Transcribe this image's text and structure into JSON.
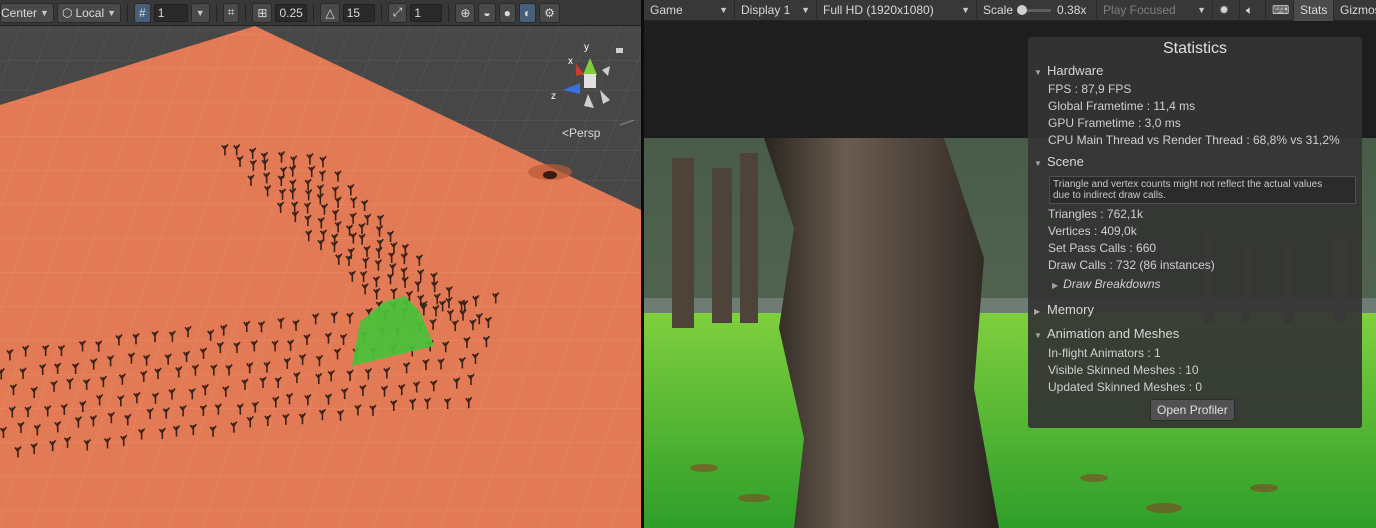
{
  "scene_toolbar": {
    "pivot_label": "Center",
    "space_label": "Local",
    "grid_value": "1",
    "snap_value": "0.25",
    "rotate_snap_value": "15",
    "scale_snap_value": "1"
  },
  "scene_view": {
    "camera_mode": "Persp",
    "gizmo_axes": {
      "x": "x",
      "y": "y",
      "z": "z"
    }
  },
  "game_toolbar": {
    "view_label": "Game",
    "display_label": "Display 1",
    "resolution_label": "Full HD (1920x1080)",
    "scale_label": "Scale",
    "scale_value": "0.38x",
    "play_focused_label": "Play Focused",
    "stats_label": "Stats",
    "gizmos_label": "Gizmos"
  },
  "stats": {
    "title": "Statistics",
    "hardware": {
      "label": "Hardware",
      "fps": "FPS : 87,9 FPS",
      "global_frametime": "Global Frametime : 11,4 ms",
      "gpu_frametime": "GPU Frametime : 3,0 ms",
      "cpu_main": "CPU Main Thread vs Render Thread : 68,8% vs 31,2%"
    },
    "scene": {
      "label": "Scene",
      "note_line1": "Triangle and vertex counts might not reflect the actual values",
      "note_line2": "due to indirect draw calls.",
      "triangles": "Triangles : 762,1k",
      "vertices": "Vertices : 409,0k",
      "set_pass": "Set Pass Calls : 660",
      "draw_calls": "Draw Calls : 732 (86 instances)",
      "draw_breakdowns": "Draw Breakdowns"
    },
    "memory": {
      "label": "Memory"
    },
    "animation": {
      "label": "Animation and Meshes",
      "inflight": "In-flight Animators : 1",
      "visible_skinned": "Visible Skinned Meshes : 10",
      "updated_skinned": "Updated Skinned Meshes : 0"
    },
    "open_profiler": "Open Profiler"
  },
  "colors": {
    "scene_ground": "#e27a55",
    "selection_green": "#47c23a",
    "toolbar_bg": "#383838",
    "panel_bg": "#343434"
  }
}
